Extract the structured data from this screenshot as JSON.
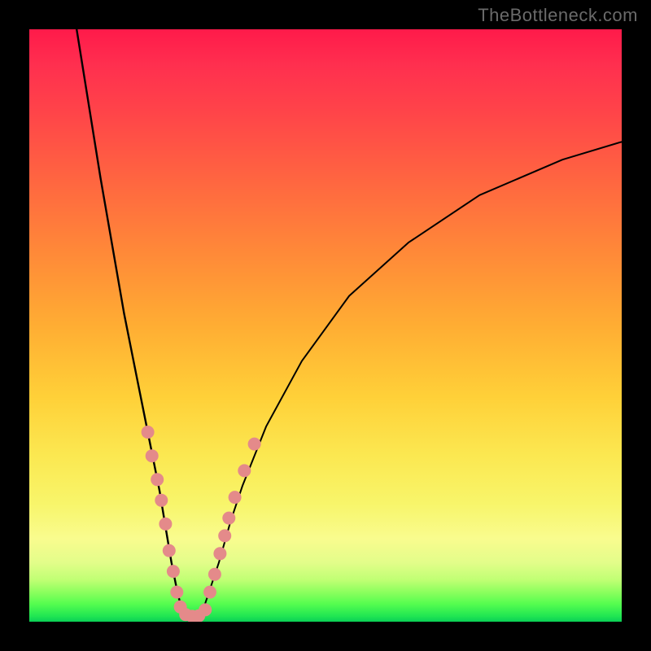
{
  "watermark": "TheBottleneck.com",
  "colors": {
    "background": "#000000",
    "curve": "#000000",
    "marker_fill": "#e48a8a",
    "marker_stroke": "#d66f6f",
    "gradient_stops": [
      "#ff1a4a",
      "#ff2f4f",
      "#ff4449",
      "#ff6740",
      "#ff8a38",
      "#ffad33",
      "#ffd038",
      "#fbe851",
      "#f8f56a",
      "#f9fc8e",
      "#e3fd8a",
      "#bfff73",
      "#8cff5e",
      "#55fd4f",
      "#22e752",
      "#0acf56"
    ]
  },
  "chart_data": {
    "type": "line",
    "title": "",
    "xlabel": "",
    "ylabel": "",
    "xlim": [
      0,
      100
    ],
    "ylim": [
      0,
      100
    ],
    "series": [
      {
        "name": "left-branch",
        "x": [
          8,
          12,
          16,
          18,
          20,
          21,
          22,
          23,
          24,
          25,
          26
        ],
        "y": [
          100,
          75,
          52,
          42,
          32,
          27,
          22,
          16,
          10,
          5,
          1
        ]
      },
      {
        "name": "right-branch",
        "x": [
          29,
          30,
          32,
          34,
          36,
          40,
          46,
          54,
          64,
          76,
          90,
          100
        ],
        "y": [
          1,
          4,
          10,
          17,
          23,
          33,
          44,
          55,
          64,
          72,
          78,
          81
        ]
      }
    ],
    "scatter": {
      "name": "markers",
      "points": [
        {
          "x": 20.0,
          "y": 32.0
        },
        {
          "x": 20.7,
          "y": 28.0
        },
        {
          "x": 21.6,
          "y": 24.0
        },
        {
          "x": 22.3,
          "y": 20.5
        },
        {
          "x": 23.0,
          "y": 16.5
        },
        {
          "x": 23.6,
          "y": 12.0
        },
        {
          "x": 24.3,
          "y": 8.5
        },
        {
          "x": 24.9,
          "y": 5.0
        },
        {
          "x": 25.5,
          "y": 2.5
        },
        {
          "x": 26.4,
          "y": 1.2
        },
        {
          "x": 27.5,
          "y": 0.9
        },
        {
          "x": 28.6,
          "y": 1.0
        },
        {
          "x": 29.7,
          "y": 2.0
        },
        {
          "x": 30.5,
          "y": 5.0
        },
        {
          "x": 31.3,
          "y": 8.0
        },
        {
          "x": 32.2,
          "y": 11.5
        },
        {
          "x": 33.0,
          "y": 14.5
        },
        {
          "x": 33.7,
          "y": 17.5
        },
        {
          "x": 34.7,
          "y": 21.0
        },
        {
          "x": 36.3,
          "y": 25.5
        },
        {
          "x": 38.0,
          "y": 30.0
        }
      ]
    },
    "curve_min": {
      "x": 27.5,
      "y": 0.8
    }
  }
}
